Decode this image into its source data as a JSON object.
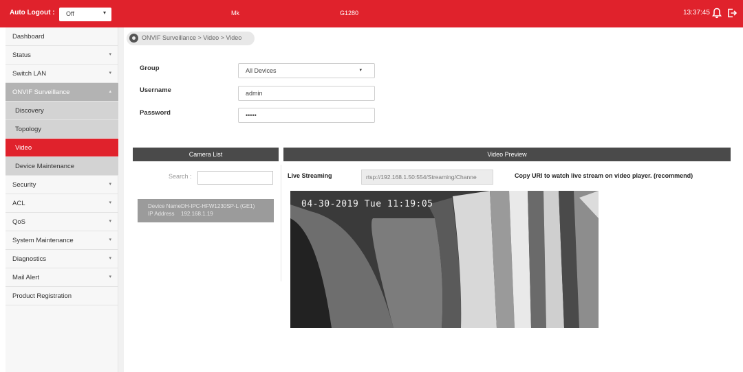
{
  "topbar": {
    "auto_logout_label": "Auto Logout :",
    "auto_logout_value": "Off",
    "model_a": "Mk",
    "model_b": "G1280",
    "time": "13:37:45",
    "accent_color": "#e0222c"
  },
  "sidebar": {
    "items": [
      {
        "label": "Dashboard"
      },
      {
        "label": "Status"
      },
      {
        "label": "Switch LAN"
      },
      {
        "label": "ONVIF Surveillance"
      },
      {
        "label": "Discovery"
      },
      {
        "label": "Topology"
      },
      {
        "label": "Video"
      },
      {
        "label": "Device Maintenance"
      },
      {
        "label": "Security"
      },
      {
        "label": "ACL"
      },
      {
        "label": "QoS"
      },
      {
        "label": "System Maintenance"
      },
      {
        "label": "Diagnostics"
      },
      {
        "label": "Mail Alert"
      },
      {
        "label": "Product Registration"
      }
    ],
    "active": "Video"
  },
  "breadcrumb": {
    "text": "ONVIF Surveillance > Video > Video"
  },
  "form": {
    "group_label": "Group",
    "group_value": "All Devices",
    "username_label": "Username",
    "username_value": "admin",
    "password_label": "Password",
    "password_value": "•••••"
  },
  "camera_list": {
    "title": "Camera List",
    "search_label": "Search :",
    "search_value": "",
    "device_name_label": "Device Name",
    "device_name_value": "DH-IPC-HFW1230SP-L (GE1)",
    "ip_label": "IP Address",
    "ip_value": "192.168.1.19"
  },
  "video_preview": {
    "title": "Video Preview",
    "live_label": "Live Streaming",
    "uri": "rtsp://192.168.1.50:554/Streaming/Channe",
    "copy_note": "Copy URI to watch live stream on video player. (recommend)",
    "timestamp": "04-30-2019 Tue 11:19:05"
  },
  "icons": {
    "location": "location-pin-icon",
    "bell": "bell-icon",
    "logout": "logout-icon"
  }
}
